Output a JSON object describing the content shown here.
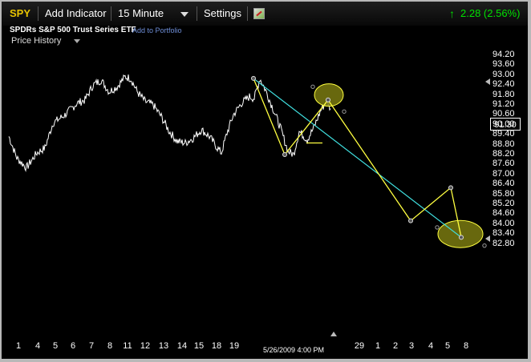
{
  "toolbar": {
    "symbol": "SPY",
    "add_indicator": "Add Indicator",
    "interval": "15 Minute",
    "settings": "Settings",
    "change_icon": "up-arrow-icon",
    "change_value": "2.28 (2.56%)"
  },
  "security_name": "SPDRs S&P 500 Trust Series ETF",
  "add_to_portfolio": "Add to Portfolio",
  "panel_title": "Price History",
  "current_price": "91.30",
  "date_label": "5/26/2009 4:00 PM",
  "colors": {
    "background": "#000000",
    "price": "#ffffff",
    "pattern": "#ffff40",
    "trendline": "#40e0e0",
    "symbol": "#e8c400",
    "change": "#00e000"
  },
  "chart_data": {
    "type": "line",
    "y_ticks": [
      "94.20",
      "93.60",
      "93.00",
      "92.40",
      "91.80",
      "91.20",
      "90.60",
      "90.00",
      "89.40",
      "88.80",
      "88.20",
      "87.60",
      "87.00",
      "86.40",
      "85.80",
      "85.20",
      "84.60",
      "84.00",
      "83.40",
      "82.80"
    ],
    "ylim": [
      82.4,
      94.6
    ],
    "x_tick_labels": [
      "1",
      "4",
      "5",
      "6",
      "7",
      "8",
      "11",
      "12",
      "13",
      "14",
      "15",
      "18",
      "19",
      "29",
      "1",
      "2",
      "3",
      "4",
      "5",
      "8"
    ],
    "price_anchors": [
      [
        0,
        89.3
      ],
      [
        10,
        88.0
      ],
      [
        22,
        87.4
      ],
      [
        35,
        88.3
      ],
      [
        45,
        88.6
      ],
      [
        55,
        90.1
      ],
      [
        70,
        90.6
      ],
      [
        85,
        91.3
      ],
      [
        95,
        91.5
      ],
      [
        105,
        92.4
      ],
      [
        115,
        92.7
      ],
      [
        125,
        92.0
      ],
      [
        135,
        92.3
      ],
      [
        145,
        92.9
      ],
      [
        152,
        92.8
      ],
      [
        160,
        92.0
      ],
      [
        170,
        91.4
      ],
      [
        180,
        91.2
      ],
      [
        190,
        90.5
      ],
      [
        200,
        89.6
      ],
      [
        210,
        89.0
      ],
      [
        220,
        88.9
      ],
      [
        230,
        89.2
      ],
      [
        240,
        89.7
      ],
      [
        250,
        89.3
      ],
      [
        260,
        88.6
      ],
      [
        265,
        88.3
      ],
      [
        272,
        89.5
      ],
      [
        280,
        90.6
      ],
      [
        290,
        91.3
      ],
      [
        300,
        91.7
      ],
      [
        306,
        91.6
      ],
      [
        313,
        92.8
      ],
      [
        320,
        92.1
      ],
      [
        330,
        90.9
      ],
      [
        338,
        89.9
      ],
      [
        348,
        88.4
      ],
      [
        355,
        88.2
      ],
      [
        362,
        89.6
      ],
      [
        372,
        89.1
      ],
      [
        380,
        89.8
      ],
      [
        390,
        91.0
      ],
      [
        397,
        91.4
      ],
      [
        402,
        90.9
      ]
    ],
    "pattern_points": [
      [
        314,
        92.8
      ],
      [
        353,
        88.2
      ],
      [
        407,
        91.5
      ],
      [
        510,
        84.2
      ],
      [
        560,
        86.2
      ],
      [
        573,
        83.2
      ]
    ],
    "trendline": [
      [
        314,
        92.8
      ],
      [
        573,
        83.2
      ]
    ],
    "pattern_extras": [
      [
        380,
        88.9
      ],
      [
        400,
        88.9
      ]
    ],
    "highlight_circles": [
      {
        "x": 408,
        "y": 91.8,
        "rx": 18,
        "ry": 14
      },
      {
        "x": 572,
        "y": 83.4,
        "rx": 28,
        "ry": 17
      }
    ],
    "small_markers": [
      [
        388,
        92.3
      ],
      [
        427,
        90.8
      ],
      [
        543,
        83.8
      ],
      [
        602,
        82.7
      ]
    ]
  }
}
